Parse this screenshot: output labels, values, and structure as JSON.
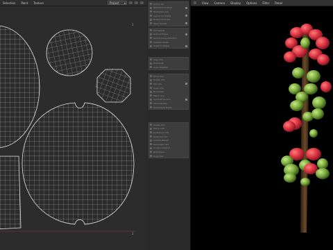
{
  "uv_editor": {
    "menu": [
      "Selection",
      "Paint",
      "Texture"
    ],
    "dropdown_value": "Project"
  },
  "viewport": {
    "menu": [
      "View",
      "Camera",
      "Display",
      "Options",
      "Filter",
      "Panel"
    ]
  },
  "toolbox": {
    "groups": [
      [
        "Unfold 3D",
        "Optimize UV Shell",
        "Straighten UVs",
        "Layout UV Shells",
        "Orient UV Shells",
        "Stack Similar"
      ],
      [
        "Cut Seams",
        "Sew UV Edges",
        "Unfold Along Direction",
        "Unstack Shells",
        "Orient to Edges"
      ],
      [
        "Align UVs",
        "Distribute",
        "Snap Together"
      ],
      [
        "Move UVs",
        "Rotate UVs",
        "Flip UVs",
        "Scale UVs",
        "Normalize",
        "Match Grid",
        "Symmetrize UVs",
        "Texel Density",
        "Randomize Shells"
      ],
      [
        "Create UVs",
        "Planar UVs",
        "Cylindrical UVs",
        "Spherical UVs",
        "Camera-Based",
        "Automatic UVs",
        "Contour Stretch",
        "Best Plane",
        "Copy UVs"
      ]
    ]
  }
}
